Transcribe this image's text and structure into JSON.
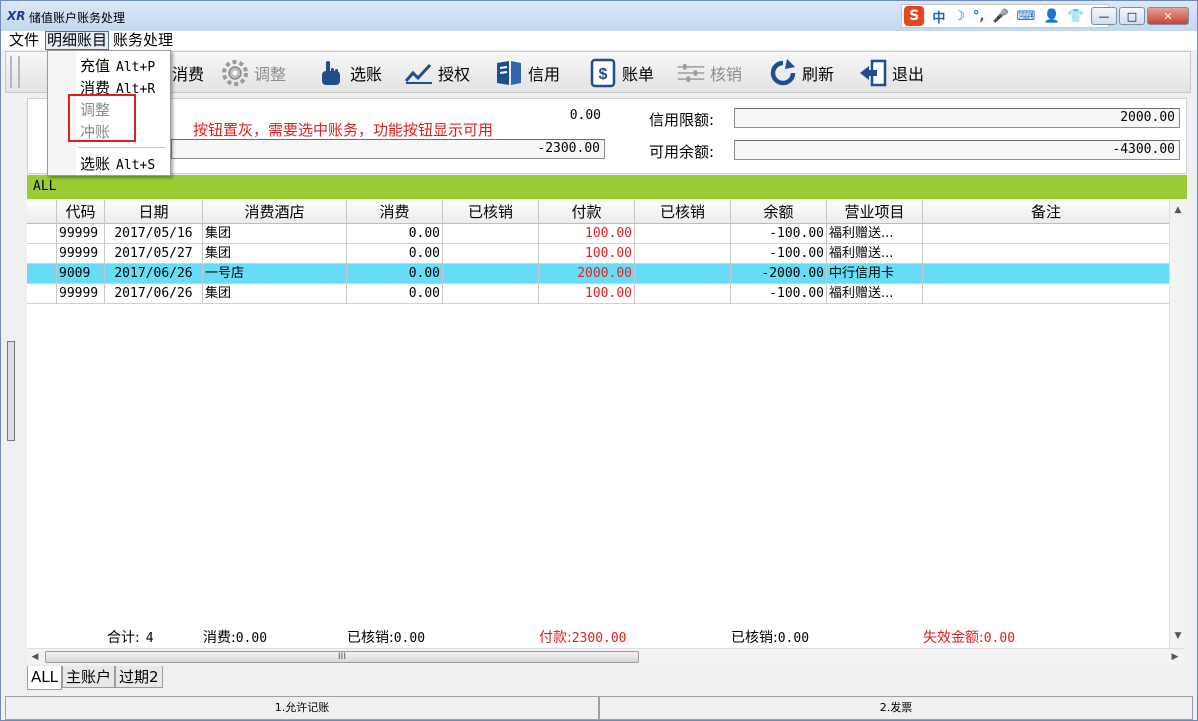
{
  "window": {
    "logo": "XR",
    "title": "储值账户账务处理",
    "ime": {
      "logo": "S",
      "items": [
        "中",
        "☽",
        "°,",
        "🎤",
        "⌨",
        "👤",
        "👕",
        "🔧"
      ]
    },
    "controls": {
      "minimize": "—",
      "maximize": "□",
      "close": "✕"
    }
  },
  "menubar": {
    "items": [
      "文件",
      "明细账目",
      "账务处理"
    ]
  },
  "dropdown": {
    "items": [
      {
        "label": "充值",
        "shortcut": "Alt+P",
        "enabled": true
      },
      {
        "label": "消费",
        "shortcut": "Alt+R",
        "enabled": true
      },
      {
        "label": "调整",
        "shortcut": "",
        "enabled": false
      },
      {
        "label": "冲账",
        "shortcut": "",
        "enabled": false
      },
      {
        "label": "选账",
        "shortcut": "Alt+S",
        "enabled": true
      }
    ]
  },
  "toolbar": {
    "buttons": [
      {
        "label": "消费",
        "icon": "consume-icon",
        "enabled": true
      },
      {
        "label": "调整",
        "icon": "gear-icon",
        "enabled": false
      },
      {
        "label": "选账",
        "icon": "hand-pointer-icon",
        "enabled": true
      },
      {
        "label": "授权",
        "icon": "check-chart-icon",
        "enabled": true
      },
      {
        "label": "信用",
        "icon": "credit-book-icon",
        "enabled": true
      },
      {
        "label": "账单",
        "icon": "dollar-bill-icon",
        "enabled": true
      },
      {
        "label": "核销",
        "icon": "slider-icon",
        "enabled": false
      },
      {
        "label": "刷新",
        "icon": "refresh-icon",
        "enabled": true
      },
      {
        "label": "退出",
        "icon": "exit-icon",
        "enabled": true
      }
    ]
  },
  "annotation": "按钮置灰，需要选中账务，功能按钮显示可用",
  "summary": {
    "left_value_1": "0.00",
    "left_value_2": "-2300.00",
    "credit_limit_label": "信用限额:",
    "credit_limit_value": "2000.00",
    "available_label": "可用余额:",
    "available_value": "-4300.00"
  },
  "filter_label": "ALL",
  "grid": {
    "columns": [
      "",
      "代码",
      "日期",
      "消费酒店",
      "消费",
      "已核销",
      "付款",
      "已核销",
      "余额",
      "营业项目",
      "备注"
    ],
    "rows": [
      {
        "code": "99999",
        "date": "2017/05/16",
        "hotel": "集团",
        "consume": "0.00",
        "verified1": "",
        "payment": "100.00",
        "verified2": "",
        "balance": "-100.00",
        "item": "福利赠送...",
        "remark": "",
        "selected": false
      },
      {
        "code": "99999",
        "date": "2017/05/27",
        "hotel": "集团",
        "consume": "0.00",
        "verified1": "",
        "payment": "100.00",
        "verified2": "",
        "balance": "-100.00",
        "item": "福利赠送...",
        "remark": "",
        "selected": false
      },
      {
        "code": "9009",
        "date": "2017/06/26",
        "hotel": "一号店",
        "consume": "0.00",
        "verified1": "",
        "payment": "2000.00",
        "verified2": "",
        "balance": "-2000.00",
        "item": "中行信用卡",
        "remark": "",
        "selected": true
      },
      {
        "code": "99999",
        "date": "2017/06/26",
        "hotel": "集团",
        "consume": "0.00",
        "verified1": "",
        "payment": "100.00",
        "verified2": "",
        "balance": "-100.00",
        "item": "福利赠送...",
        "remark": "",
        "selected": false
      }
    ]
  },
  "totals": {
    "count_label": "合计:",
    "count_value": "4",
    "consume_label": "消费:",
    "consume_value": "0.00",
    "verified1_label": "已核销:",
    "verified1_value": "0.00",
    "payment_label": "付款:",
    "payment_value": "2300.00",
    "verified2_label": "已核销:",
    "verified2_value": "0.00",
    "invalid_label": "失效金额:",
    "invalid_value": "0.00"
  },
  "scroll": {
    "up": "▲",
    "down": "▼",
    "left": "◀",
    "right": "▶",
    "grip": "III"
  },
  "tabs": [
    "ALL",
    "主账户",
    "过期2"
  ],
  "statusbar": [
    "1.允许记账",
    "2.发票"
  ],
  "colors": {
    "accent_green": "#99cc33",
    "selected_row": "#66ddf7",
    "annotation_red": "#e02020"
  }
}
